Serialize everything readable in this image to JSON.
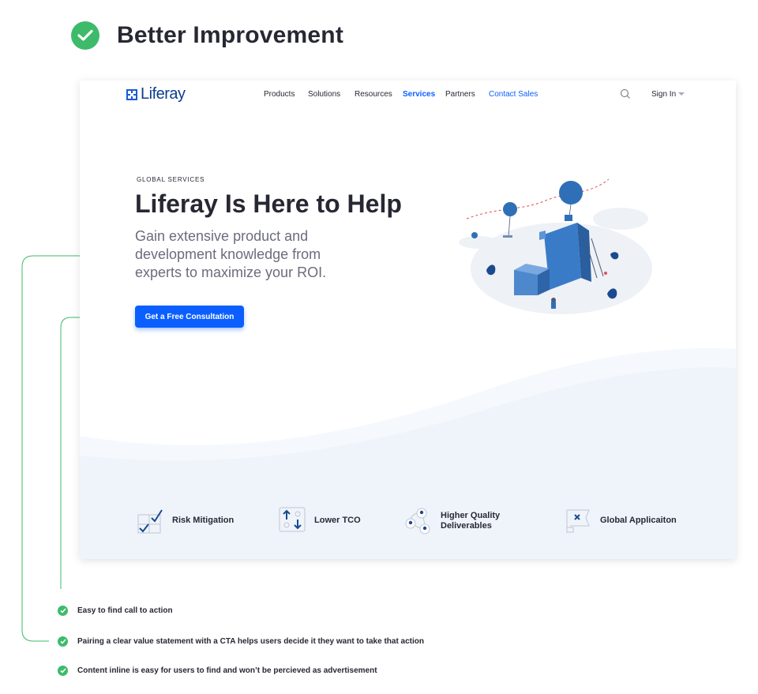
{
  "header": {
    "title": "Better Improvement"
  },
  "nav": {
    "logo": "Liferay",
    "items": [
      {
        "label": "Products"
      },
      {
        "label": "Solutions"
      },
      {
        "label": "Resources"
      },
      {
        "label": "Services"
      },
      {
        "label": "Partners"
      },
      {
        "label": "Contact Sales"
      }
    ],
    "active": "Services",
    "sign_in": "Sign In"
  },
  "hero": {
    "eyebrow": "GLOBAL SERVICES",
    "title": "Liferay Is Here to Help",
    "subtitle": "Gain extensive product and development knowledge from experts to maximize your ROI.",
    "cta_label": "Get a Free Consultation"
  },
  "features": [
    {
      "label": "Risk Mitigation",
      "icon": "checklist-icon"
    },
    {
      "label": "Lower TCO",
      "icon": "arrows-icon"
    },
    {
      "label": "Higher Quality Deliverables",
      "icon": "people-network-icon"
    },
    {
      "label": "Global Applicaiton",
      "icon": "flag-icon"
    }
  ],
  "notes": [
    {
      "text": "Easy to find call to action"
    },
    {
      "text": "Pairing a clear value statement with a CTA helps users decide it they want to take that action"
    },
    {
      "text": "Content inline is easy for users to find and won’t be percieved as advertisement"
    }
  ],
  "colors": {
    "accent": "#0b5fff",
    "check": "#3dbb6a",
    "text": "#272833",
    "muted": "#6b6c7e"
  }
}
